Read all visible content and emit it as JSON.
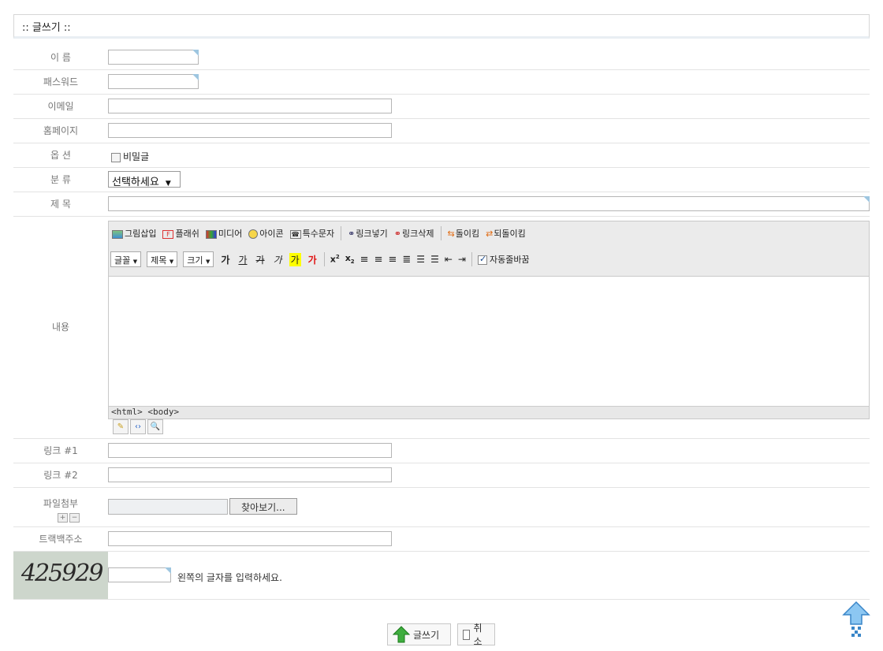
{
  "page_title": ":: 글쓰기 ::",
  "form": {
    "name_label": "이 름",
    "password_label": "패스워드",
    "email_label": "이메일",
    "homepage_label": "홈페이지",
    "option_label": "옵 션",
    "secret_label": "비밀글",
    "category_label": "분 류",
    "category_value": "선택하세요",
    "subject_label": "제 목",
    "content_label": "내용",
    "link1_label": "링크 #1",
    "link2_label": "링크 #2",
    "file_label": "파일첨부",
    "file_button": "찾아보기...",
    "trackback_label": "트랙백주소",
    "captcha_text": "425929",
    "captcha_hint": "왼쪽의 글자를 입력하세요."
  },
  "editor": {
    "toolbar1": [
      "그림삽입",
      "플래쉬",
      "미디어",
      "아이콘",
      "특수문자",
      "링크넣기",
      "링크삭제",
      "돌이킴",
      "되돌이킴"
    ],
    "font_dropdown": "글꼴",
    "style_dropdown": "제목",
    "size_dropdown": "크기",
    "format_glyph": "가",
    "autowrap_label": "자동줄바꿈",
    "status_path": "<html> <body>"
  },
  "actions": {
    "submit_label": "글쓰기",
    "cancel_label": "취소"
  },
  "colors": {
    "highlight": "#ffff00",
    "red_text": "#e01010",
    "arrow_blue": "#4ea3e6"
  }
}
